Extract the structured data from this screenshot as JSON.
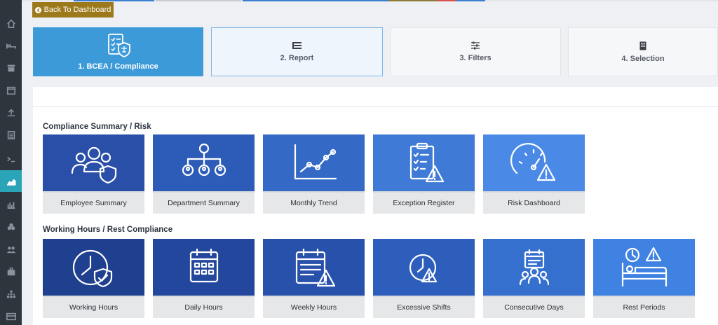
{
  "back_button": {
    "label": "Back To Dashboard",
    "icon": "arrow-left-icon"
  },
  "steps": [
    {
      "label": "1. BCEA / Compliance",
      "state": "done",
      "icon": "compliance-docs-icon"
    },
    {
      "label": "2. Report",
      "state": "current",
      "icon": "list-icon"
    },
    {
      "label": "3. Filters",
      "state": "idle",
      "icon": "sliders-icon"
    },
    {
      "label": "4. Selection",
      "state": "idle",
      "icon": "building-icon"
    }
  ],
  "sections": [
    {
      "title": "Compliance Summary / Risk",
      "tiles": [
        {
          "label": "Employee Summary",
          "color": "#2a4fa8",
          "icon": "employees-shield-icon"
        },
        {
          "label": "Department Summary",
          "color": "#2d5bb8",
          "icon": "org-chart-icon"
        },
        {
          "label": "Monthly Trend",
          "color": "#3569c6",
          "icon": "line-trend-icon"
        },
        {
          "label": "Exception Register",
          "color": "#3f7bd6",
          "icon": "clipboard-warning-icon"
        },
        {
          "label": "Risk Dashboard",
          "color": "#4a8ae6",
          "icon": "gauge-warning-icon"
        }
      ]
    },
    {
      "title": "Working Hours / Rest Compliance",
      "tiles": [
        {
          "label": "Working Hours",
          "color": "#1f3f8f",
          "icon": "clock-shield-icon"
        },
        {
          "label": "Daily Hours",
          "color": "#22479c",
          "icon": "calendar-icon"
        },
        {
          "label": "Weekly Hours",
          "color": "#2751ab",
          "icon": "calendar-warning-icon"
        },
        {
          "label": "Excessive Shifts",
          "color": "#2d5ebb",
          "icon": "clock-warning-icon"
        },
        {
          "label": "Consecutive Days",
          "color": "#3670cf",
          "icon": "people-calendar-icon"
        },
        {
          "label": "Rest Periods",
          "color": "#3f82e2",
          "icon": "bed-clock-icon"
        }
      ]
    }
  ]
}
